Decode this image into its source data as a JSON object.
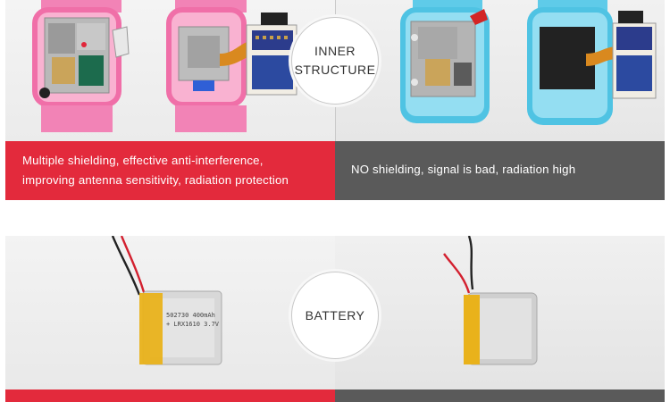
{
  "section_inner": {
    "badge_line1": "INNER",
    "badge_line2": "STRUCTURE",
    "left_caption_line1": "Multiple shielding, effective anti-interference,",
    "left_caption_line2": "improving antenna sensitivity, radiation protection",
    "right_caption": "NO shielding, signal is bad, radiation high"
  },
  "section_battery": {
    "badge": "BATTERY",
    "left_battery_label_line1": "502730 400mAh",
    "left_battery_label_line2": "+ LRX1610  3.7V"
  },
  "colors": {
    "accent_red": "#e32a3c",
    "band_gray": "#5a5a5a",
    "watch_pink": "#f06fa8",
    "watch_blue": "#4fc3e3"
  }
}
